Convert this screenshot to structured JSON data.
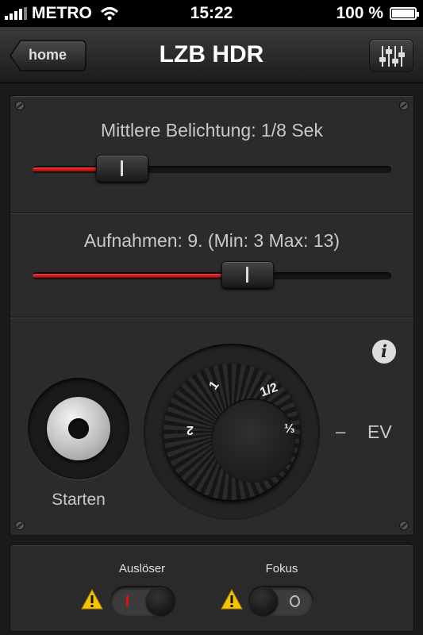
{
  "status_bar": {
    "carrier": "METRO",
    "time": "15:22",
    "battery": "100 %",
    "signal_icon": "signal-bars-icon",
    "wifi_icon": "wifi-icon",
    "battery_icon": "battery-icon"
  },
  "nav": {
    "back_label": "home",
    "title": "LZB HDR",
    "settings_icon": "equalizer-icon"
  },
  "exposure_slider": {
    "label": "Mittlere Belichtung: 1/8 Sek",
    "value_fraction": 0.25
  },
  "shots_slider": {
    "label": "Aufnahmen: 9. (Min: 3 Max: 13)",
    "value_fraction": 0.6
  },
  "info_button": {
    "label": "i"
  },
  "start_button": {
    "label": "Starten"
  },
  "ev_dial": {
    "marks": [
      "1",
      "1/2",
      "⅓",
      "2"
    ],
    "minus_label": "–",
    "unit_label": "EV"
  },
  "switches": [
    {
      "label": "Auslöser",
      "state": "on",
      "warning_icon": "warning-icon"
    },
    {
      "label": "Fokus",
      "state": "off",
      "warning_icon": "warning-icon"
    }
  ],
  "colors": {
    "accent_red": "#cc1111",
    "warning_yellow": "#f5c400"
  }
}
